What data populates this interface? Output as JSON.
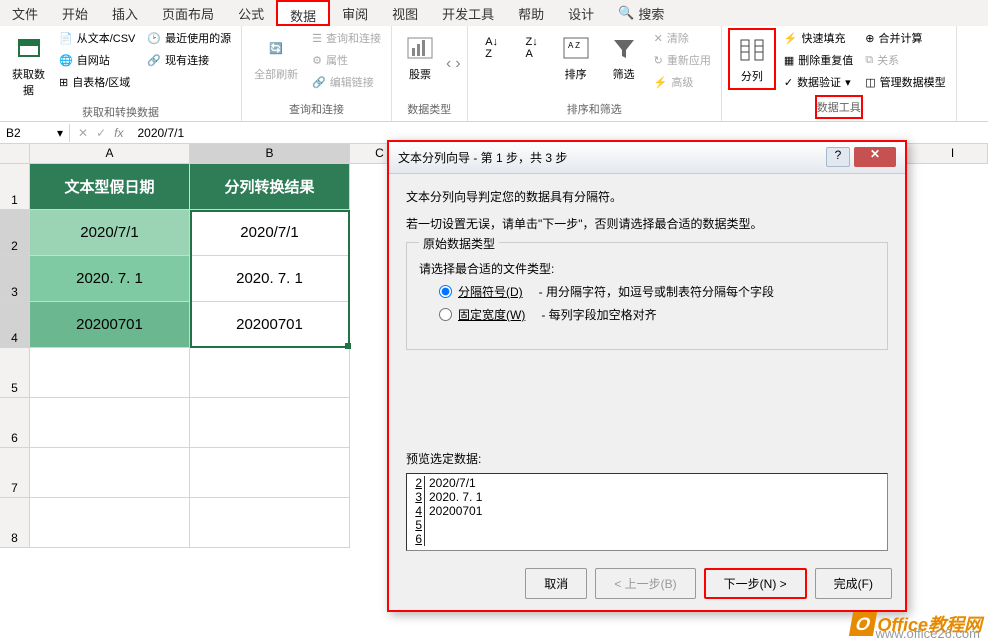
{
  "tabs": {
    "file": "文件",
    "home": "开始",
    "insert": "插入",
    "page_layout": "页面布局",
    "formulas": "公式",
    "data": "数据",
    "review": "审阅",
    "view": "视图",
    "dev": "开发工具",
    "help": "帮助",
    "design": "设计",
    "search": "搜索"
  },
  "ribbon": {
    "get_data": "获取数\n据",
    "from_text": "从文本/CSV",
    "from_web": "自网站",
    "from_table": "自表格/区域",
    "recent": "最近使用的源",
    "existing": "现有连接",
    "group1_label": "获取和转换数据",
    "refresh_all": "全部刷新",
    "queries": "查询和连接",
    "properties": "属性",
    "edit_links": "编辑链接",
    "group2_label": "查询和连接",
    "stocks": "股票",
    "group3_label": "数据类型",
    "sort": "排序",
    "filter": "筛选",
    "clear": "清除",
    "reapply": "重新应用",
    "advanced": "高级",
    "group4_label": "排序和筛选",
    "text_to_cols": "分列",
    "flash_fill": "快速填充",
    "remove_dup": "删除重复值",
    "data_val": "数据验证",
    "consolidate": "合并计算",
    "relations": "关系",
    "manage_model": "管理数据模型",
    "group5_label": "数据工具"
  },
  "formula_bar": {
    "name_box": "B2",
    "value": "2020/7/1"
  },
  "grid": {
    "cols": {
      "A": "A",
      "B": "B",
      "C": "C",
      "I": "I"
    },
    "rows": {
      "1": "1",
      "2": "2",
      "3": "3",
      "4": "4",
      "5": "5",
      "6": "6",
      "7": "7",
      "8": "8"
    },
    "headers": {
      "A": "文本型假日期",
      "B": "分列转换结果"
    },
    "data": [
      {
        "A": "2020/7/1",
        "B": "2020/7/1"
      },
      {
        "A": "2020. 7. 1",
        "B": "2020. 7. 1"
      },
      {
        "A": "20200701",
        "B": "20200701"
      }
    ]
  },
  "dialog": {
    "title": "文本分列向导 - 第 1 步，共 3 步",
    "line1": "文本分列向导判定您的数据具有分隔符。",
    "line2": "若一切设置无误，请单击\"下一步\"，否则请选择最合适的数据类型。",
    "fieldset_legend": "原始数据类型",
    "choose_label": "请选择最合适的文件类型:",
    "radio1": "分隔符号(D)",
    "radio1_desc": "- 用分隔字符，如逗号或制表符分隔每个字段",
    "radio2": "固定宽度(W)",
    "radio2_desc": "- 每列字段加空格对齐",
    "preview_label": "预览选定数据:",
    "preview_rows": [
      {
        "n": "2",
        "v": "2020/7/1"
      },
      {
        "n": "3",
        "v": "2020. 7. 1"
      },
      {
        "n": "4",
        "v": "20200701"
      },
      {
        "n": "5",
        "v": ""
      },
      {
        "n": "6",
        "v": ""
      }
    ],
    "btn_cancel": "取消",
    "btn_back": "< 上一步(B)",
    "btn_next": "下一步(N) >",
    "btn_finish": "完成(F)"
  },
  "watermark": {
    "text": "Office教程网",
    "url": "www.office26.com"
  }
}
